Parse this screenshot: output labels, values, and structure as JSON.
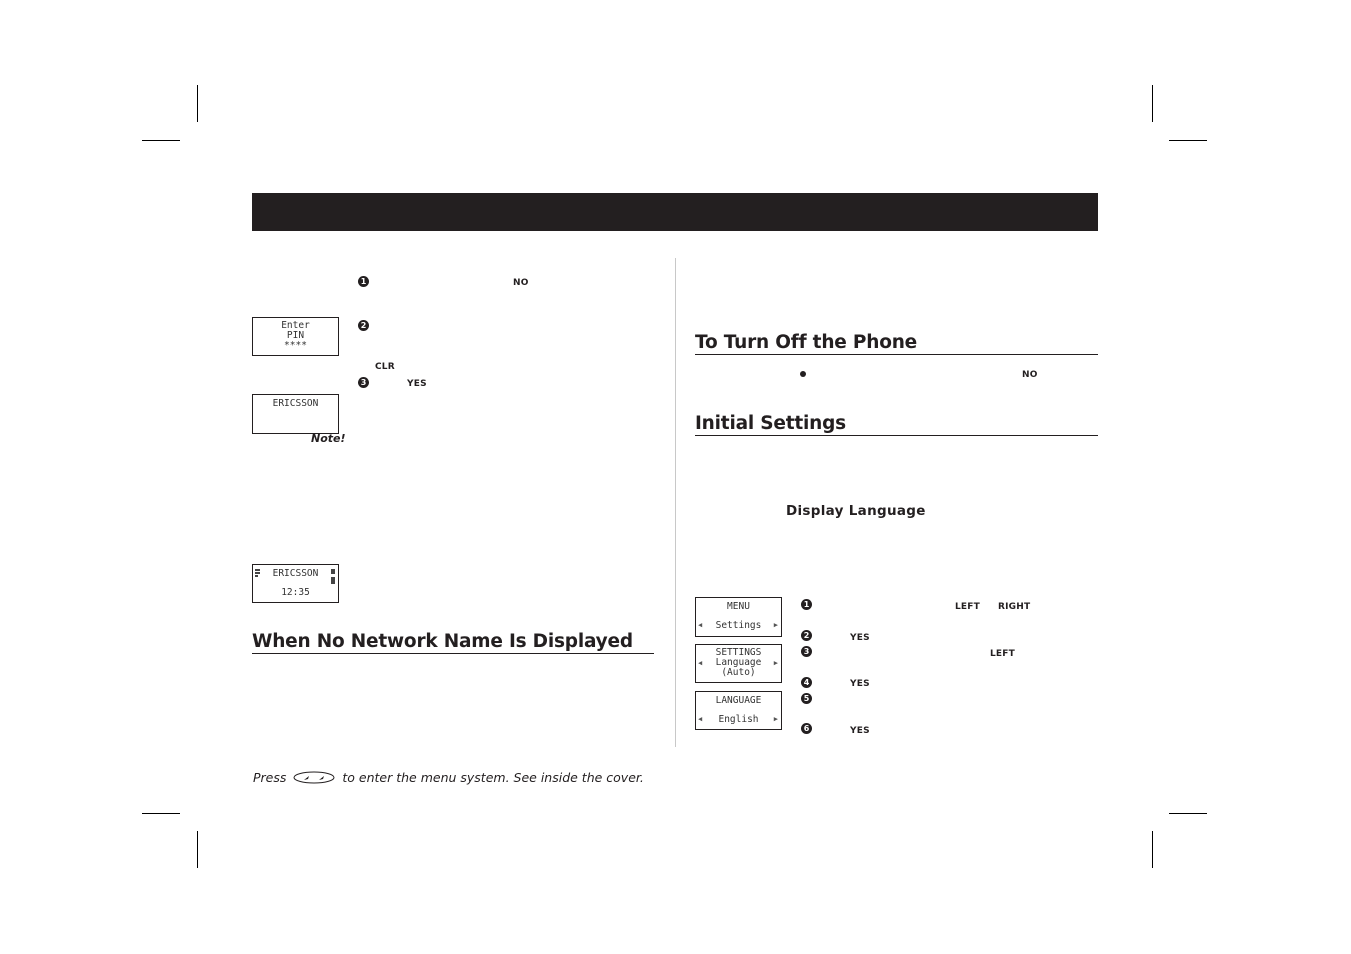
{
  "header": {
    "title": ""
  },
  "left_column": {
    "steps": [
      {
        "number": "1",
        "key": "NO"
      },
      {
        "number": "2",
        "key": ""
      },
      {
        "number": "3",
        "key": "YES"
      }
    ],
    "clr_key": "CLR",
    "note_label": "Note!",
    "lcd_pin": {
      "line1": "Enter",
      "line2": "PIN",
      "line3": "****"
    },
    "lcd_ericsson": {
      "line1": "ERICSSON"
    },
    "lcd_standby": {
      "line1": "ERICSSON",
      "line2": "12:35"
    },
    "section_heading": "When No Network Name Is Displayed"
  },
  "right_column": {
    "turn_off": {
      "heading": "To Turn Off the Phone",
      "key": "NO"
    },
    "initial_settings": {
      "heading": "Initial Settings",
      "subheading": "Display Language",
      "steps": [
        {
          "number": "1",
          "keys": [
            "LEFT",
            "RIGHT"
          ]
        },
        {
          "number": "2",
          "keys": [
            "YES"
          ]
        },
        {
          "number": "3",
          "keys": [
            "LEFT"
          ]
        },
        {
          "number": "4",
          "keys": [
            "YES"
          ]
        },
        {
          "number": "5",
          "keys": []
        },
        {
          "number": "6",
          "keys": [
            "YES"
          ]
        }
      ],
      "lcd_menu": {
        "line1": "MENU",
        "line2": "Settings"
      },
      "lcd_settings": {
        "line1": "SETTINGS",
        "line2": "Language",
        "line3": "(Auto)"
      },
      "lcd_language": {
        "line1": "LANGUAGE",
        "line2": "English"
      }
    }
  },
  "footer": {
    "prefix": "Press",
    "icon": "menu-key-icon",
    "suffix": "to enter the menu system. See inside the cover."
  }
}
